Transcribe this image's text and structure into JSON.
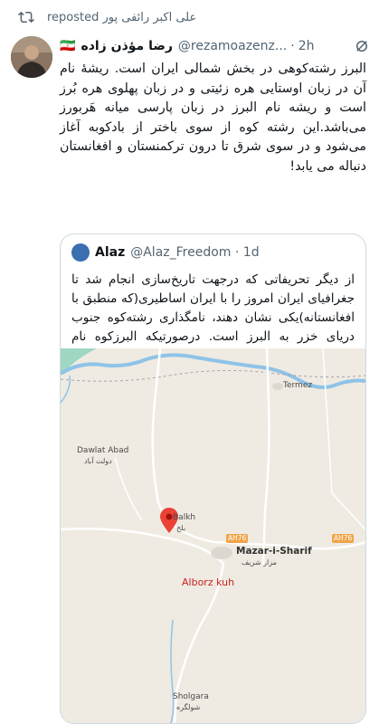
{
  "repost": {
    "text": "علی اکبر رائفی پور reposted",
    "icon": "repost-icon"
  },
  "tweet": {
    "author_name": "رضا مؤذن زاده",
    "author_flag": "🇮🇷",
    "handle": "@rezamoazenz...",
    "time": "2h",
    "text": "البرز رشته‌کوهی در بخش شمالی ایران است. ریشهٔ نام آن در زبان اوستایی هره زئیتی و در زبان پهلوی هره بُرز است و ریشه نام البرز در زبان پارسی میانه هَربورز می‌باشد.این رشته کوه از سوی باختر از بادکوبه آغاز می‌شود و در سوی شرق تا درون ترکمنستان و افغانستان دنباله می یابد!"
  },
  "quote": {
    "name": "Alaz",
    "handle": "@Alaz_Freedom",
    "time": "1d",
    "text": "از دیگر تحریفاتی که درجهت تاریخ‌سازی انجام شد تا جغرافیای ایران امروز را با ایران اساطیری(که منطبق با افغانستانه)یکی نشان دهند، نامگذاری رشته‌کوه جنوب دریای خزر به البرز است. درصورتیکه البرزکوه نام کوهی در بلخ است که با موقعیت جغرافیایی البرز مط..."
  },
  "map": {
    "places": [
      {
        "id": "termez",
        "en": "Termez",
        "fa": ""
      },
      {
        "id": "dawlat-abad",
        "en": "Dawlat Abad",
        "fa": "دولت آباد"
      },
      {
        "id": "balkh",
        "en": "Balkh",
        "fa": "بلخ"
      },
      {
        "id": "mazar",
        "en": "Mazar-i-Sharif",
        "fa": "مزار شریف"
      },
      {
        "id": "alborz",
        "en": "Alborz kuh",
        "fa": ""
      },
      {
        "id": "sholgara",
        "en": "Sholgara",
        "fa": "شولگره"
      }
    ],
    "road_shields": [
      "AH76",
      "AH76"
    ],
    "colors": {
      "land": "#efebe2",
      "river": "#8fc3e8",
      "water_green": "#9fd7c3",
      "road": "#ffffff",
      "pin": "#ea4335"
    }
  }
}
